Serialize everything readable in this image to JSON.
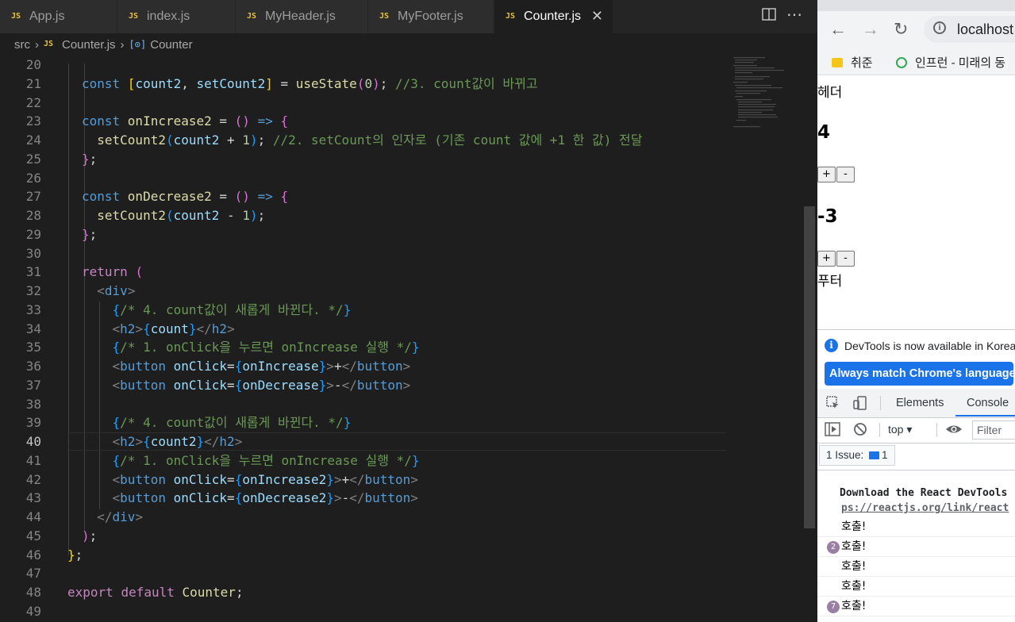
{
  "editor": {
    "tabs": [
      {
        "label": "App.js"
      },
      {
        "label": "index.js"
      },
      {
        "label": "MyHeader.js"
      },
      {
        "label": "MyFooter.js"
      },
      {
        "label": "Counter.js"
      }
    ],
    "file_badge": "JS",
    "close_glyph": "✕",
    "breadcrumb": {
      "folder": "src",
      "file": "Counter.js",
      "symbol": "Counter"
    },
    "lines": [
      {
        "no": "20",
        "segs": []
      },
      {
        "no": "21",
        "segs": [
          [
            "kw",
            "const "
          ],
          [
            "b1",
            "["
          ],
          [
            "var",
            "count2"
          ],
          [
            "",
            ","
          ],
          [
            "var",
            " setCount2"
          ],
          [
            "b1",
            "]"
          ],
          [
            "",
            " = "
          ],
          [
            "fn",
            "useState"
          ],
          [
            "b2",
            "("
          ],
          [
            "num",
            "0"
          ],
          [
            "b2",
            ")"
          ],
          [
            "",
            "; "
          ],
          [
            "cmt",
            "//3. count값이 바뀌고"
          ]
        ]
      },
      {
        "no": "22",
        "segs": []
      },
      {
        "no": "23",
        "segs": [
          [
            "kw",
            "const "
          ],
          [
            "fn",
            "onIncrease2"
          ],
          [
            "",
            " = "
          ],
          [
            "b2",
            "()"
          ],
          [
            "",
            " "
          ],
          [
            "kw",
            "=>"
          ],
          [
            "",
            " "
          ],
          [
            "b2",
            "{"
          ]
        ]
      },
      {
        "no": "24",
        "segs": [
          [
            "",
            "  "
          ],
          [
            "fn",
            "setCount2"
          ],
          [
            "b3",
            "("
          ],
          [
            "var",
            "count2"
          ],
          [
            "",
            " + "
          ],
          [
            "num",
            "1"
          ],
          [
            "b3",
            ")"
          ],
          [
            "",
            "; "
          ],
          [
            "cmt",
            "//2. setCount의 인자로 (기존 count 값에 +1 한 값) 전달"
          ]
        ]
      },
      {
        "no": "25",
        "segs": [
          [
            "b2",
            "}"
          ],
          [
            ";",
            ";"
          ]
        ]
      },
      {
        "no": "26",
        "segs": []
      },
      {
        "no": "27",
        "segs": [
          [
            "kw",
            "const "
          ],
          [
            "fn",
            "onDecrease2"
          ],
          [
            "",
            " = "
          ],
          [
            "b2",
            "()"
          ],
          [
            "",
            " "
          ],
          [
            "kw",
            "=>"
          ],
          [
            "",
            " "
          ],
          [
            "b2",
            "{"
          ]
        ]
      },
      {
        "no": "28",
        "segs": [
          [
            "",
            "  "
          ],
          [
            "fn",
            "setCount2"
          ],
          [
            "b3",
            "("
          ],
          [
            "var",
            "count2"
          ],
          [
            "",
            " - "
          ],
          [
            "num",
            "1"
          ],
          [
            "b3",
            ")"
          ],
          [
            "",
            ";"
          ]
        ]
      },
      {
        "no": "29",
        "segs": [
          [
            "b2",
            "}"
          ],
          [
            "",
            ";"
          ]
        ]
      },
      {
        "no": "30",
        "segs": []
      },
      {
        "no": "31",
        "segs": [
          [
            "ctl",
            "return "
          ],
          [
            "b2",
            "("
          ]
        ]
      },
      {
        "no": "32",
        "segs": [
          [
            "",
            "  "
          ],
          [
            "ang",
            "<"
          ],
          [
            "tag",
            "div"
          ],
          [
            "ang",
            ">"
          ]
        ]
      },
      {
        "no": "33",
        "segs": [
          [
            "",
            "    "
          ],
          [
            "b3",
            "{"
          ],
          [
            "cmt",
            "/* 4. count값이 새롭게 바뀐다. */"
          ],
          [
            "b3",
            "}"
          ]
        ]
      },
      {
        "no": "34",
        "segs": [
          [
            "",
            "    "
          ],
          [
            "ang",
            "<"
          ],
          [
            "tag",
            "h2"
          ],
          [
            "ang",
            ">"
          ],
          [
            "b3",
            "{"
          ],
          [
            "var",
            "count"
          ],
          [
            "b3",
            "}"
          ],
          [
            "ang",
            "</"
          ],
          [
            "tag",
            "h2"
          ],
          [
            "ang",
            ">"
          ]
        ]
      },
      {
        "no": "35",
        "segs": [
          [
            "",
            "    "
          ],
          [
            "b3",
            "{"
          ],
          [
            "cmt",
            "/* 1. onClick을 누르면 onIncrease 실행 */"
          ],
          [
            "b3",
            "}"
          ]
        ]
      },
      {
        "no": "36",
        "segs": [
          [
            "",
            "    "
          ],
          [
            "ang",
            "<"
          ],
          [
            "tag",
            "button"
          ],
          [
            "",
            " "
          ],
          [
            "attr",
            "onClick"
          ],
          [
            "",
            "="
          ],
          [
            "b3",
            "{"
          ],
          [
            "var",
            "onIncrease"
          ],
          [
            "b3",
            "}"
          ],
          [
            "ang",
            ">"
          ],
          [
            "",
            "+"
          ],
          [
            "ang",
            "</"
          ],
          [
            "tag",
            "button"
          ],
          [
            "ang",
            ">"
          ]
        ]
      },
      {
        "no": "37",
        "segs": [
          [
            "",
            "    "
          ],
          [
            "ang",
            "<"
          ],
          [
            "tag",
            "button"
          ],
          [
            "",
            " "
          ],
          [
            "attr",
            "onClick"
          ],
          [
            "",
            "="
          ],
          [
            "b3",
            "{"
          ],
          [
            "var",
            "onDecrease"
          ],
          [
            "b3",
            "}"
          ],
          [
            "ang",
            ">"
          ],
          [
            "",
            "-"
          ],
          [
            "ang",
            "</"
          ],
          [
            "tag",
            "button"
          ],
          [
            "ang",
            ">"
          ]
        ]
      },
      {
        "no": "38",
        "segs": []
      },
      {
        "no": "39",
        "segs": [
          [
            "",
            "    "
          ],
          [
            "b3",
            "{"
          ],
          [
            "cmt",
            "/* 4. count값이 새롭게 바뀐다. */"
          ],
          [
            "b3",
            "}"
          ]
        ]
      },
      {
        "no": "40",
        "segs": [
          [
            "",
            "    "
          ],
          [
            "ang",
            "<"
          ],
          [
            "tag",
            "h2"
          ],
          [
            "ang",
            ">"
          ],
          [
            "b3",
            "{"
          ],
          [
            "var",
            "count2"
          ],
          [
            "b3",
            "}"
          ],
          [
            "ang",
            "</"
          ],
          [
            "tag",
            "h2"
          ],
          [
            "ang",
            ">"
          ]
        ]
      },
      {
        "no": "41",
        "segs": [
          [
            "",
            "    "
          ],
          [
            "b3",
            "{"
          ],
          [
            "cmt",
            "/* 1. onClick을 누르면 onIncrease 실행 */"
          ],
          [
            "b3",
            "}"
          ]
        ]
      },
      {
        "no": "42",
        "segs": [
          [
            "",
            "    "
          ],
          [
            "ang",
            "<"
          ],
          [
            "tag",
            "button"
          ],
          [
            "",
            " "
          ],
          [
            "attr",
            "onClick"
          ],
          [
            "",
            "="
          ],
          [
            "b3",
            "{"
          ],
          [
            "var",
            "onIncrease2"
          ],
          [
            "b3",
            "}"
          ],
          [
            "ang",
            ">"
          ],
          [
            "",
            "+"
          ],
          [
            "ang",
            "</"
          ],
          [
            "tag",
            "button"
          ],
          [
            "ang",
            ">"
          ]
        ]
      },
      {
        "no": "43",
        "segs": [
          [
            "",
            "    "
          ],
          [
            "ang",
            "<"
          ],
          [
            "tag",
            "button"
          ],
          [
            "",
            " "
          ],
          [
            "attr",
            "onClick"
          ],
          [
            "",
            "="
          ],
          [
            "b3",
            "{"
          ],
          [
            "var",
            "onDecrease2"
          ],
          [
            "b3",
            "}"
          ],
          [
            "ang",
            ">"
          ],
          [
            "",
            "-"
          ],
          [
            "ang",
            "</"
          ],
          [
            "tag",
            "button"
          ],
          [
            "ang",
            ">"
          ]
        ]
      },
      {
        "no": "44",
        "segs": [
          [
            "",
            "  "
          ],
          [
            "ang",
            "</"
          ],
          [
            "tag",
            "div"
          ],
          [
            "ang",
            ">"
          ]
        ]
      },
      {
        "no": "45",
        "segs": [
          [
            "b2",
            ")"
          ],
          [
            "",
            ";"
          ]
        ]
      },
      {
        "no": "46",
        "segs": [
          [
            "b1",
            "}"
          ],
          [
            "",
            ";"
          ]
        ]
      },
      {
        "no": "47",
        "segs": []
      },
      {
        "no": "48",
        "segs": [
          [
            "ctl",
            "export "
          ],
          [
            "ctl",
            "default "
          ],
          [
            "fn",
            "Counter"
          ],
          [
            "",
            ";"
          ]
        ]
      },
      {
        "no": "49",
        "segs": []
      }
    ],
    "current_line": "40"
  },
  "browser": {
    "url": "localhost",
    "bookmarks": [
      "취준",
      "인프런 - 미래의 동"
    ],
    "page": {
      "header_text": "헤더",
      "count1": "4",
      "count2": "-3",
      "plus_label": "+",
      "minus_label": "-",
      "footer_text": "푸터"
    },
    "devtools": {
      "notice": "DevTools is now available in Korean",
      "match_button": "Always match Chrome's language",
      "tabs": [
        "Elements",
        "Console"
      ],
      "context": "top",
      "filter_placeholder": "Filter",
      "issues_label": "1 Issue:",
      "issues_count": "1",
      "react_msg_1": "Download the React DevTools",
      "react_msg_2": "ps://reactjs.org/link/react",
      "logs": [
        {
          "count": "",
          "text": "호출!"
        },
        {
          "count": "2",
          "text": "호출!"
        },
        {
          "count": "",
          "text": "호출!"
        },
        {
          "count": "",
          "text": "호출!"
        },
        {
          "count": "7",
          "text": "호출!"
        }
      ]
    }
  }
}
